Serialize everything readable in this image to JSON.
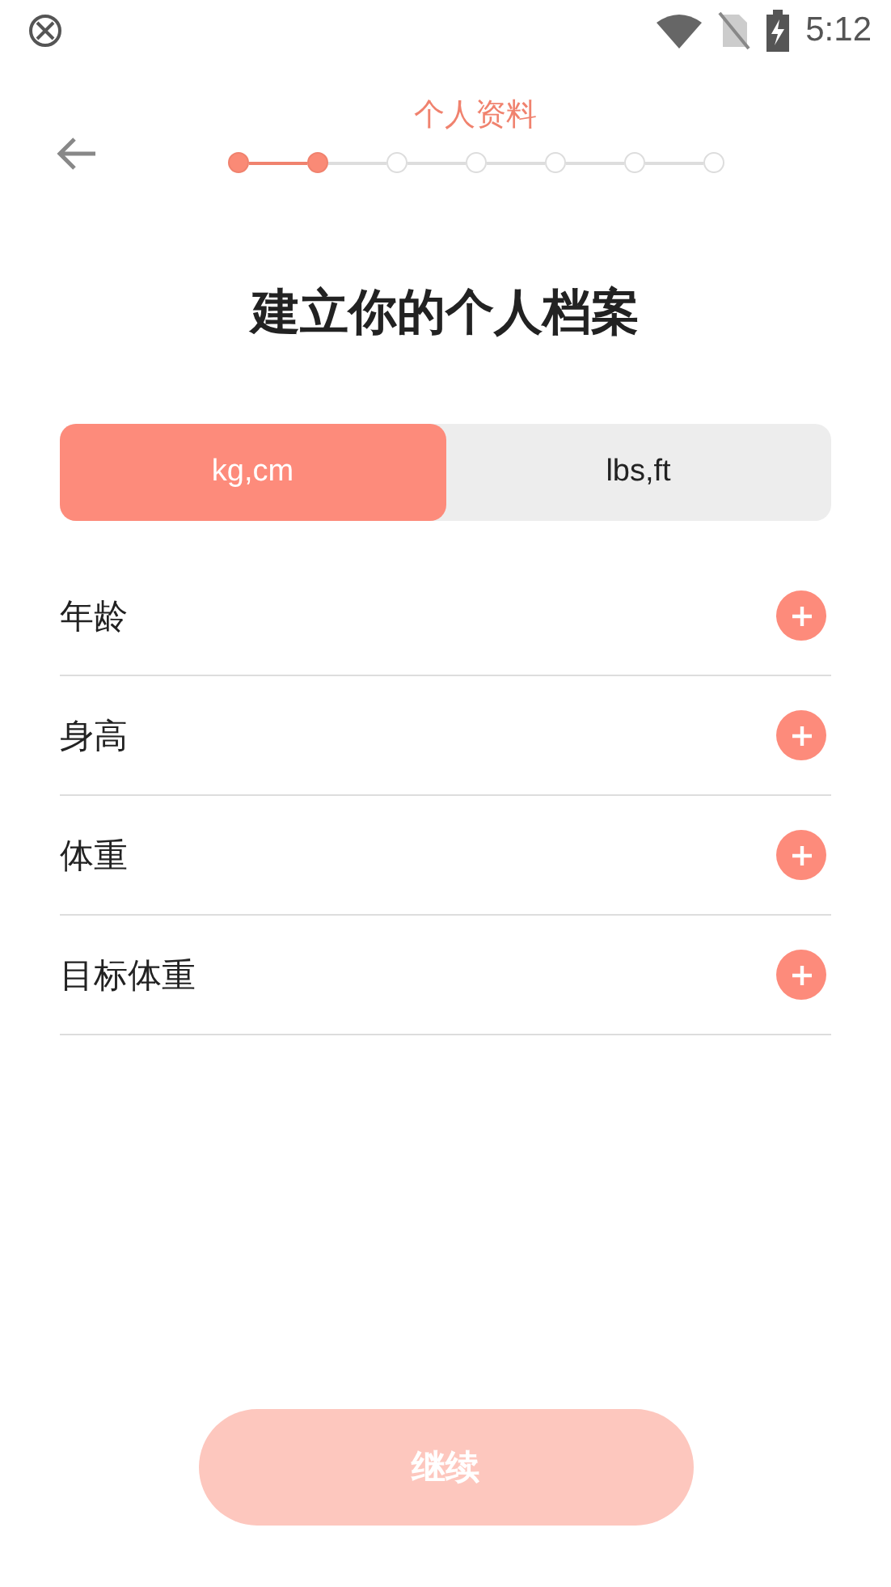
{
  "status_bar": {
    "time": "5:12"
  },
  "header": {
    "title": "个人资料",
    "steps": [
      {
        "done": true
      },
      {
        "done": true
      },
      {
        "done": false
      },
      {
        "done": false
      },
      {
        "done": false
      },
      {
        "done": false
      },
      {
        "done": false
      }
    ]
  },
  "heading": "建立你的个人档案",
  "units": [
    {
      "label": "kg,cm",
      "selected": true
    },
    {
      "label": "lbs,ft",
      "selected": false
    }
  ],
  "fields": [
    {
      "label": "年龄"
    },
    {
      "label": "身高"
    },
    {
      "label": "体重"
    },
    {
      "label": "目标体重"
    }
  ],
  "continue_button": {
    "label": "继续",
    "disabled": true
  }
}
